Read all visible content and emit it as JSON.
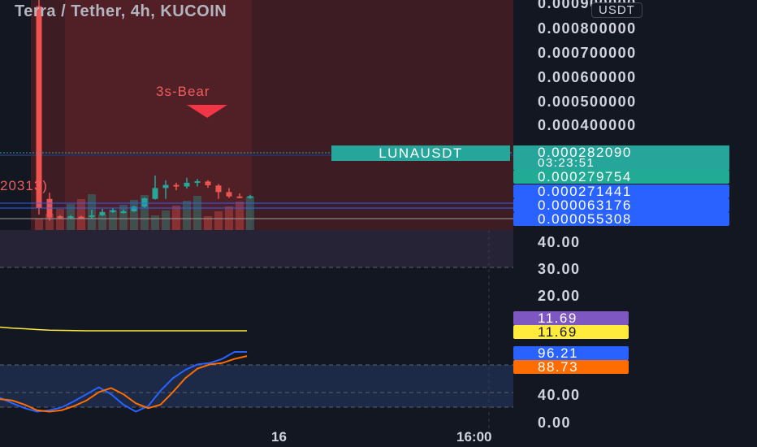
{
  "header": {
    "title": "Terra / Tether, 4h, KUCOIN"
  },
  "pattern": {
    "label": "3s-Bear",
    "partial_label": "20313)"
  },
  "symbol_tag": "LUNAUSDT",
  "price_axis": {
    "currency": "USDT",
    "ticks": [
      "0.000900000",
      "0.000800000",
      "0.000700000",
      "0.000600000",
      "0.000500000",
      "0.000400000"
    ],
    "last_price": "0.000282090",
    "countdown": "03:23:51",
    "level_tags": [
      {
        "value": "0.000279754",
        "color": "#22ab94"
      },
      {
        "value": "0.000271441",
        "color": "#2962ff"
      },
      {
        "value": "0.000063176",
        "color": "#2962ff"
      },
      {
        "value": "0.000055308",
        "color": "#2962ff"
      }
    ]
  },
  "indicator_axis": {
    "ticks": [
      "40.00",
      "30.00",
      "20.00",
      "40.00",
      "0.00"
    ],
    "tags": [
      {
        "value": "11.69",
        "bg": "#7e57c2",
        "fg": "#ffffff"
      },
      {
        "value": "11.69",
        "bg": "#ffeb3b",
        "fg": "#131722"
      },
      {
        "value": "96.21",
        "bg": "#2962ff",
        "fg": "#ffffff"
      },
      {
        "value": "88.73",
        "bg": "#ff6d00",
        "fg": "#ffffff"
      }
    ]
  },
  "time_axis": {
    "ticks": [
      "16",
      "16:00"
    ]
  },
  "colors": {
    "up": "#26a69a",
    "down": "#ef5350",
    "stoch_k": "#2962ff",
    "stoch_d": "#ff6d00",
    "adx": "#ffeb3b"
  },
  "chart_data": [
    {
      "type": "candlestick",
      "title": "Terra / Tether, 4h, KUCOIN",
      "ylabel": "USDT",
      "ylim": [
        0.0002,
        0.00094
      ],
      "candles": [
        {
          "o": 0.00092,
          "h": 0.00094,
          "l": 0.00025,
          "c": 0.00027
        },
        {
          "o": 0.0003,
          "h": 0.00032,
          "l": 0.00023,
          "c": 0.00024
        },
        {
          "o": 0.000244,
          "h": 0.000248,
          "l": 0.000238,
          "c": 0.000241
        },
        {
          "o": 0.00024,
          "h": 0.000248,
          "l": 0.000236,
          "c": 0.000244
        },
        {
          "o": 0.000243,
          "h": 0.000246,
          "l": 0.000239,
          "c": 0.000241
        },
        {
          "o": 0.000242,
          "h": 0.000265,
          "l": 0.000236,
          "c": 0.000247
        },
        {
          "o": 0.000247,
          "h": 0.000268,
          "l": 0.000245,
          "c": 0.000258
        },
        {
          "o": 0.000258,
          "h": 0.00027,
          "l": 0.000255,
          "c": 0.000263
        },
        {
          "o": 0.00026,
          "h": 0.000266,
          "l": 0.000252,
          "c": 0.00026
        },
        {
          "o": 0.00026,
          "h": 0.000278,
          "l": 0.000258,
          "c": 0.000275
        },
        {
          "o": 0.000275,
          "h": 0.000305,
          "l": 0.000272,
          "c": 0.000302
        },
        {
          "o": 0.0003,
          "h": 0.000375,
          "l": 0.000298,
          "c": 0.000335
        },
        {
          "o": 0.000335,
          "h": 0.00036,
          "l": 0.0003,
          "c": 0.000345
        },
        {
          "o": 0.000345,
          "h": 0.000352,
          "l": 0.000328,
          "c": 0.00034
        },
        {
          "o": 0.00034,
          "h": 0.000368,
          "l": 0.000333,
          "c": 0.000352
        },
        {
          "o": 0.000352,
          "h": 0.000364,
          "l": 0.00034,
          "c": 0.000357
        },
        {
          "o": 0.000356,
          "h": 0.00036,
          "l": 0.000336,
          "c": 0.000344
        },
        {
          "o": 0.000343,
          "h": 0.000348,
          "l": 0.0003,
          "c": 0.000322
        },
        {
          "o": 0.000322,
          "h": 0.000335,
          "l": 0.000303,
          "c": 0.000308
        },
        {
          "o": 0.000308,
          "h": 0.000318,
          "l": 0.000302,
          "c": 0.000303
        },
        {
          "o": 0.000303,
          "h": 0.000313,
          "l": 0.0003,
          "c": 0.000309
        }
      ]
    },
    {
      "type": "line",
      "title": "",
      "ylim": [
        0,
        48
      ],
      "series": [
        {
          "values": [
            26,
            25.5,
            25.2,
            24.8,
            24.5,
            24.4,
            24.3,
            24.2,
            24.2,
            24.2,
            24.2,
            24.2,
            24.2,
            24.2,
            24.2,
            24.2,
            24.2,
            24.2,
            24.2,
            24.2,
            24.2
          ]
        }
      ]
    },
    {
      "type": "line",
      "title": "",
      "ylim": [
        0,
        96
      ],
      "series": [
        {
          "values": [
            30,
            22,
            15,
            10,
            12,
            16,
            25,
            35,
            45,
            35,
            20,
            10,
            18,
            40,
            58,
            70,
            78,
            80,
            86,
            96,
            96
          ]
        },
        {
          "values": [
            28,
            26,
            20,
            12,
            10,
            12,
            18,
            26,
            38,
            44,
            35,
            22,
            15,
            20,
            38,
            58,
            72,
            78,
            80,
            86,
            90
          ]
        }
      ]
    }
  ]
}
